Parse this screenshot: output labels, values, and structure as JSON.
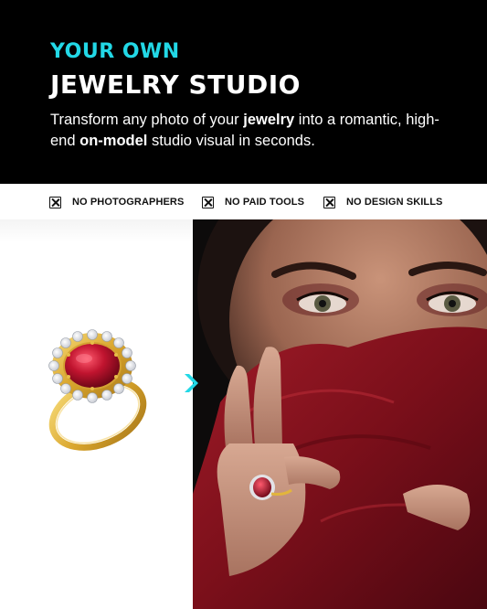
{
  "hero": {
    "eyebrow": "YOUR OWN",
    "headline": "JEWELRY STUDIO",
    "subtitle": {
      "part1": "Transform any photo of your ",
      "bold1": "jewelry",
      "part2": " into a romantic, high-end ",
      "bold2": "on-model",
      "part3": " studio visual in seconds."
    }
  },
  "features": [
    {
      "icon": "x-box-icon",
      "label": "NO PHOTOGRAPHERS"
    },
    {
      "icon": "x-box-icon",
      "label": "NO PAID TOOLS"
    },
    {
      "icon": "x-box-icon",
      "label": "NO DESIGN SKILLS"
    }
  ],
  "before": {
    "icon": "gold-ruby-ring"
  },
  "arrow": {
    "icon": "chevron-right-icon"
  },
  "after": {
    "icon": "model-wearing-ring-photo"
  },
  "colors": {
    "accent": "#22d8e6",
    "background": "#000000",
    "ruby": "#b3122a",
    "gold": "#e2b53c",
    "veil": "#8f1420"
  }
}
